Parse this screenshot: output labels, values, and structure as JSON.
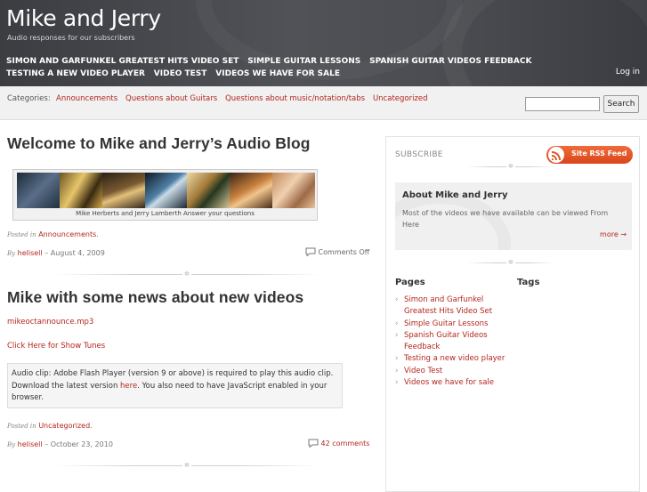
{
  "site": {
    "title": "Mike and Jerry",
    "description": "Audio responses for our subscribers"
  },
  "nav": {
    "items": [
      "SIMON AND GARFUNKEL GREATEST HITS VIDEO SET",
      "SIMPLE GUITAR LESSONS",
      "SPANISH GUITAR VIDEOS FEEDBACK",
      "TESTING A NEW VIDEO PLAYER",
      "VIDEO TEST",
      "VIDEOS WE HAVE FOR SALE"
    ],
    "login": "Log in"
  },
  "categories_bar": {
    "label": "Categories:",
    "items": [
      "Announcements",
      "Questions about Guitars",
      "Questions about music/notation/tabs",
      "Uncategorized"
    ],
    "search_button": "Search"
  },
  "posts": [
    {
      "title": "Welcome to Mike and Jerry’s Audio Blog",
      "image_caption": "Mike Herberts and Jerry Lamberth Answer your questions",
      "posted_in_label": "Posted in",
      "category": "Announcements",
      "period": ".",
      "by_label": "By",
      "author": "helisell",
      "date": "– August 4, 2009",
      "comments": "Comments Off"
    },
    {
      "title": "Mike with some news about new videos",
      "file_link": "mikeoctannounce.mp3",
      "show_tunes_link": "Click Here for Show Tunes",
      "audio_notice_1": "Audio clip: Adobe Flash Player (version 9 or above) is required to play this audio clip. Download the latest version ",
      "audio_notice_link": "here",
      "audio_notice_2": ". You also need to have JavaScript enabled in your browser.",
      "posted_in_label": "Posted in",
      "category": "Uncategorized",
      "period": ".",
      "by_label": "By",
      "author": "helisell",
      "date": "– October 23, 2010",
      "comments": "42 comments"
    }
  ],
  "sidebar": {
    "subscribe_label": "SUBSCRIBE",
    "rss_label": "Site RSS Feed",
    "about_title": "About Mike and Jerry",
    "about_text": "Most of the videos we have available can be viewed From Here",
    "about_more": "more →",
    "pages_head": "Pages",
    "tags_head": "Tags",
    "pages": [
      "Simon and Garfunkel Greatest Hits Video Set",
      "Simple Guitar Lessons",
      "Spanish Guitar Videos Feedback",
      "Testing a new video player",
      "Video Test",
      "Videos we have for sale"
    ]
  },
  "colors": {
    "header_bg": "#4a4c51",
    "link": "#b3261e",
    "rss": "#e05524"
  },
  "icons": [
    "rss-icon",
    "comment-icon"
  ]
}
